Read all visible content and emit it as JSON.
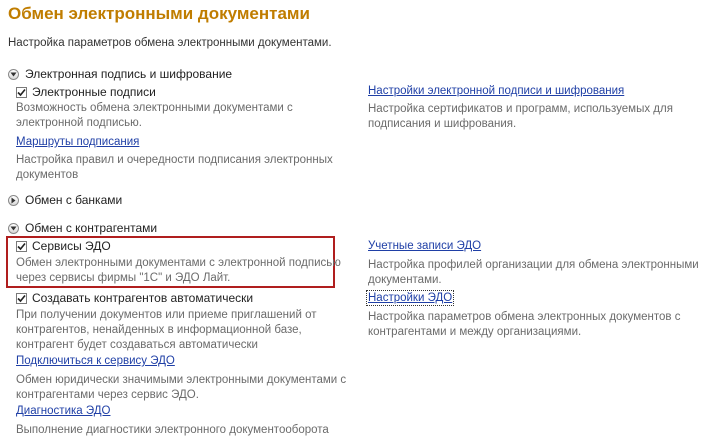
{
  "page": {
    "title": "Обмен электронными документами",
    "subtitle": "Настройка параметров обмена электронными документами."
  },
  "sections": {
    "signature": {
      "label": "Электронная подпись и шифрование",
      "checkbox_label": "Электронные подписи",
      "checkbox_desc": [
        "Возможность обмена электронными документами с",
        "электронной подписью."
      ],
      "routes_link": "Маршруты подписания",
      "routes_desc": [
        "Настройка правил и очередности подписания электронных",
        "документов"
      ],
      "settings_link": "Настройки электронной подписи и шифрования",
      "settings_desc": [
        "Настройка сертификатов и программ, используемых для",
        "подписания и шифрования."
      ]
    },
    "banks": {
      "label": "Обмен с банками"
    },
    "contractors": {
      "label": "Обмен с контрагентами",
      "edo_label": "Сервисы ЭДО",
      "edo_desc": [
        "Обмен электронными документами с электронной подписью",
        "через сервисы фирмы \"1С\" и ЭДО Лайт."
      ],
      "auto_label": "Создавать контрагентов автоматически",
      "auto_desc": [
        "При получении документов или приеме приглашений от",
        "контрагентов, ненайденных в информационной базе,",
        "контрагент будет создаваться автоматически"
      ],
      "connect_link": "Подключиться к сервису ЭДО",
      "connect_desc": [
        "Обмен юридически значимыми электронными документами с",
        "контрагентами через сервис ЭДО."
      ],
      "diag_link": "Диагностика ЭДО",
      "diag_desc": "Выполнение диагностики электронного документооборота",
      "accounts_link": "Учетные записи ЭДО",
      "accounts_desc": [
        "Настройка профилей организации для обмена электронными",
        "документами."
      ],
      "edo_settings_link": "Настройки ЭДО",
      "edo_settings_desc": [
        "Настройка параметров обмена электронных документов с",
        "контрагентами и между организациями."
      ]
    }
  },
  "colors": {
    "title": "#c07d00",
    "link": "#1f3fa6",
    "highlight": "#b01e1e"
  }
}
